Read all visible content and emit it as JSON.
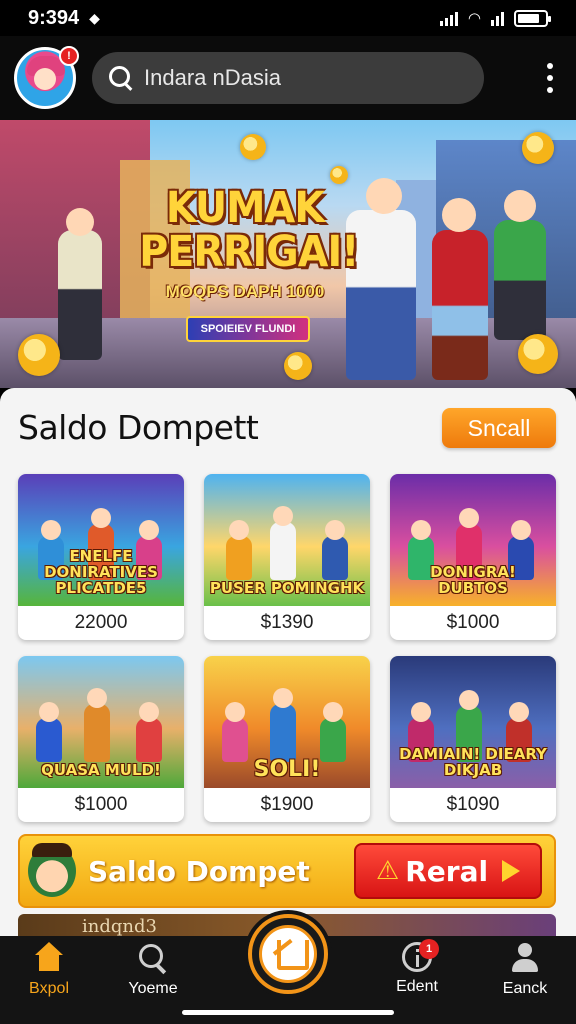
{
  "status_bar": {
    "time": "9:394"
  },
  "header": {
    "avatar_badge": "!",
    "search_placeholder": "Indara nDasia"
  },
  "hero": {
    "title": "KUMAK PERRIGAI!",
    "subtitle": "MOQPS DAPH 1000",
    "tag": "SPOIEIEV FLUNDI"
  },
  "wallet": {
    "title": "Saldo Dompett",
    "action_label": "Sncall"
  },
  "games": [
    {
      "title": "ENELFE DONIRATIVES PLICATDE5",
      "price": "22000",
      "bg": [
        "#5a3fb8",
        "#3aa5e0",
        "#57b53a"
      ]
    },
    {
      "title": "PUSER POMINGHK",
      "price": "$1390",
      "bg": [
        "#4fb3f0",
        "#ffd66a",
        "#6ac04a"
      ]
    },
    {
      "title": "DONIGRA! DUBTOS",
      "price": "$1000",
      "bg": [
        "#6b2da8",
        "#d94f9f",
        "#f7b12a"
      ]
    },
    {
      "title": "QUASA MULD!",
      "price": "$1000",
      "bg": [
        "#7cc8f0",
        "#e8b06a",
        "#4ea83a"
      ]
    },
    {
      "title": "SOLI!",
      "price": "$1900",
      "bg": [
        "#f8d24a",
        "#f08a2a",
        "#9a4a2a"
      ]
    },
    {
      "title": "DAMIAIN! DIEARY DIKJAB",
      "price": "$1090",
      "bg": [
        "#2a3a7a",
        "#4f6fc0",
        "#8a5fa8"
      ]
    }
  ],
  "promo": {
    "text": "Saldo Dompet",
    "button_label": "Reral"
  },
  "strip": {
    "text": "indqnd3"
  },
  "nav": {
    "items": [
      {
        "label": "Bxpol"
      },
      {
        "label": "Yoeme"
      },
      {
        "label": "Edent",
        "badge": "1"
      },
      {
        "label": "Eanck"
      }
    ]
  }
}
